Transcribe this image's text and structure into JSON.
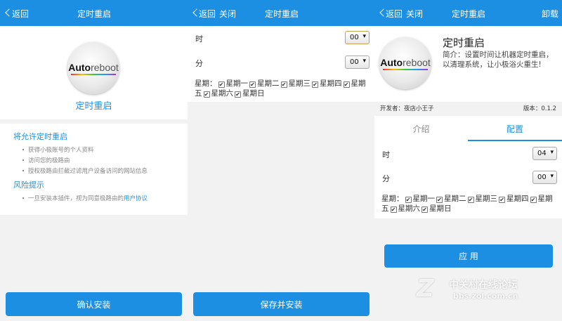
{
  "panel1": {
    "back": "返回",
    "title": "定时重启",
    "app_name": "定时重启",
    "logo_text_bold": "Auto",
    "logo_text": "reboot",
    "permissions_title": "将允许定时重启",
    "permissions": [
      "获得小极账号的个人资料",
      "访问您的极路由",
      "授权极路由拦截过滤用户设备访问的网站信息"
    ],
    "risk_title": "风险提示",
    "risk_text": "一旦安装本插件，视为同意极路由的",
    "risk_link": "用户协议",
    "confirm": "确认安装"
  },
  "panel2": {
    "back": "返回",
    "close": "关闭",
    "title": "定时重启",
    "hour_label": "时",
    "hour_value": "00",
    "minute_label": "分",
    "minute_value": "00",
    "week_label": "星期：",
    "days": [
      "星期一",
      "星期二",
      "星期三",
      "星期四",
      "星期五",
      "星期六",
      "星期日"
    ],
    "save": "保存并安装"
  },
  "panel3": {
    "back": "返回",
    "close": "关闭",
    "title": "定时重启",
    "uninstall": "卸载",
    "app_name": "定时重启",
    "description": "简介：设置时间让机器定时重启，以清理系统，让小极浴火重生!",
    "developer": "开发者：夜店小王子",
    "version": "版本：0.1.2",
    "tabs": [
      "介绍",
      "配置"
    ],
    "hour_label": "时",
    "hour_value": "04",
    "minute_label": "分",
    "minute_value": "00",
    "week_label": "星期：",
    "days": [
      "星期一",
      "星期二",
      "星期三",
      "星期四",
      "星期五",
      "星期六",
      "星期日"
    ],
    "apply": "应 用"
  },
  "watermark": {
    "name": "中关村在线论坛",
    "url": "bbs.zol.com.cn"
  },
  "colors": {
    "accent": "#1c8fe2"
  }
}
